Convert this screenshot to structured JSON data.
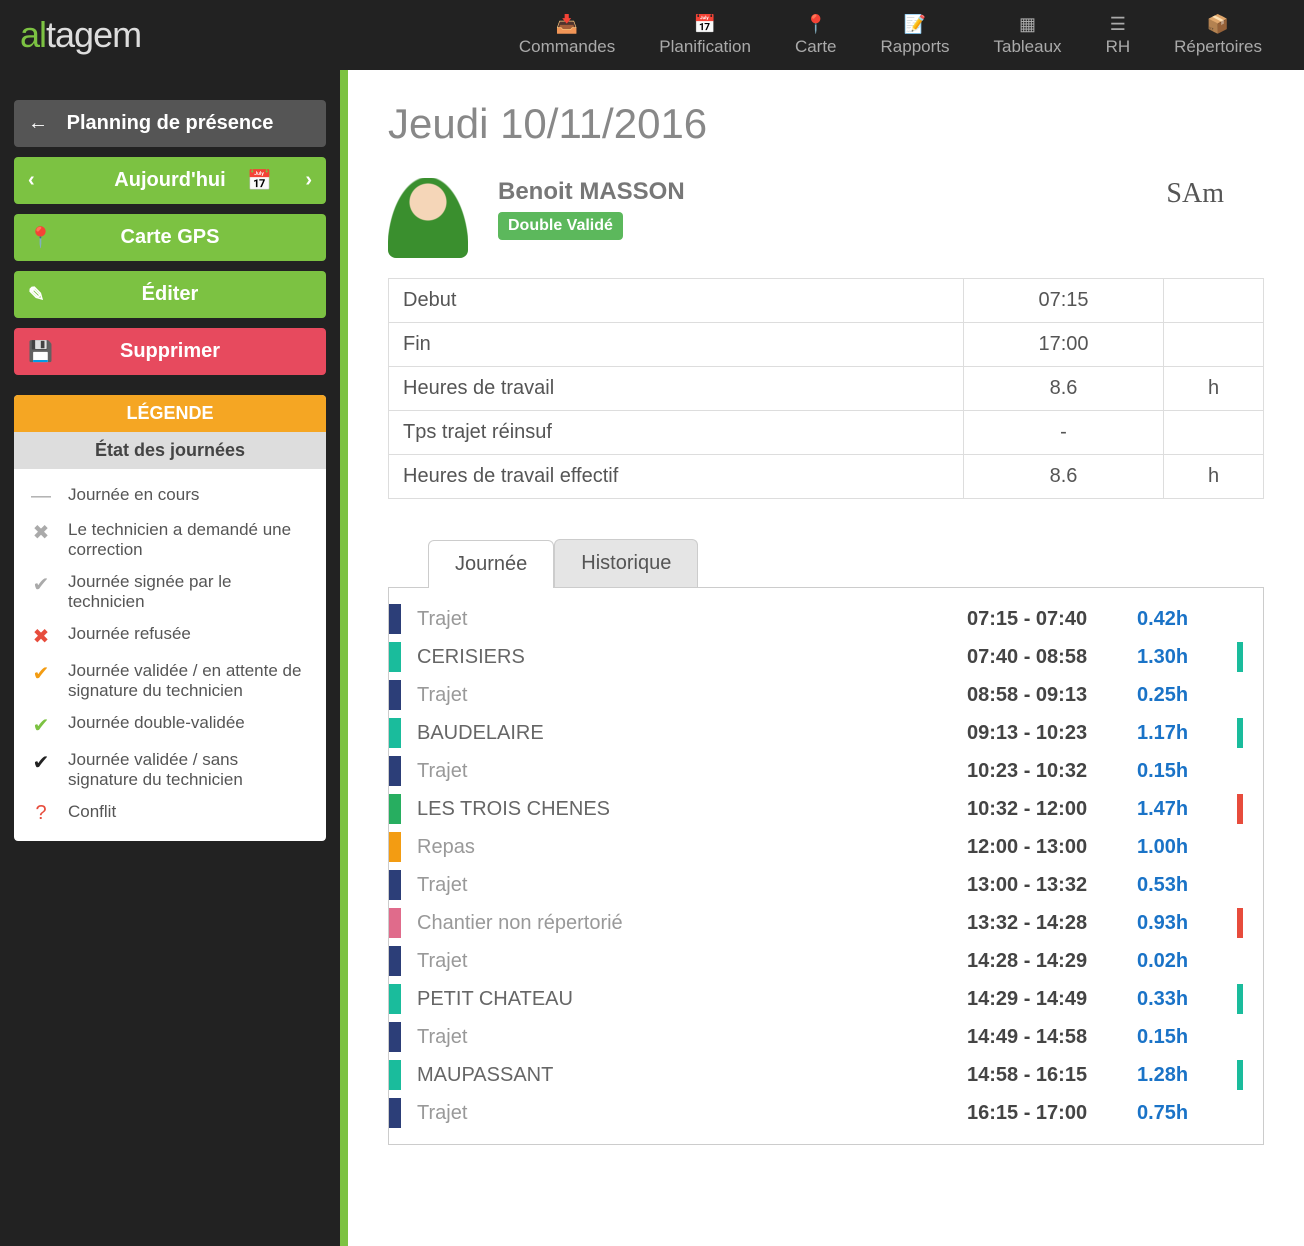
{
  "topnav": [
    {
      "icon": "📥",
      "label": "Commandes"
    },
    {
      "icon": "📅",
      "label": "Planification"
    },
    {
      "icon": "📍",
      "label": "Carte"
    },
    {
      "icon": "📝",
      "label": "Rapports"
    },
    {
      "icon": "▦",
      "label": "Tableaux"
    },
    {
      "icon": "☰",
      "label": "RH"
    },
    {
      "icon": "📦",
      "label": "Répertoires"
    }
  ],
  "sidebar": {
    "back": "Planning de présence",
    "today": "Aujourd'hui",
    "gps": "Carte GPS",
    "edit": "Éditer",
    "delete": "Supprimer"
  },
  "legend": {
    "title": "LÉGENDE",
    "subtitle": "État des journées",
    "items": [
      {
        "icon": "—",
        "cls": "c-grey",
        "text": "Journée en cours"
      },
      {
        "icon": "✖",
        "cls": "c-grey",
        "text": "Le technicien a demandé une correction"
      },
      {
        "icon": "✔",
        "cls": "c-grey",
        "text": "Journée signée par le technicien"
      },
      {
        "icon": "✖",
        "cls": "c-red",
        "text": "Journée refusée"
      },
      {
        "icon": "✔",
        "cls": "c-orange",
        "text": "Journée validée / en attente de signature du technicien"
      },
      {
        "icon": "✔",
        "cls": "c-green",
        "text": "Journée double-validée"
      },
      {
        "icon": "✔",
        "cls": "c-black",
        "text": "Journée validée / sans signature du technicien"
      },
      {
        "icon": "?",
        "cls": "c-red",
        "text": "Conflit"
      }
    ]
  },
  "page": {
    "title": "Jeudi 10/11/2016",
    "person": "Benoit MASSON",
    "badge": "Double Validé",
    "signature": "SAm"
  },
  "info": [
    {
      "label": "Debut",
      "val": "07:15",
      "unit": ""
    },
    {
      "label": "Fin",
      "val": "17:00",
      "unit": ""
    },
    {
      "label": "Heures de travail",
      "val": "8.6",
      "unit": "h"
    },
    {
      "label": "Tps trajet réinsuf",
      "val": "-",
      "unit": ""
    },
    {
      "label": "Heures de travail effectif",
      "val": "8.6",
      "unit": "h"
    }
  ],
  "tabs": {
    "active": "Journée",
    "inactive": "Historique"
  },
  "rows": [
    {
      "bar": "blue",
      "label": "Trajet",
      "muted": true,
      "time": "07:15 - 07:40",
      "dur": "0.42h",
      "rbar": ""
    },
    {
      "bar": "teal",
      "label": "CERISIERS",
      "muted": false,
      "time": "07:40 - 08:58",
      "dur": "1.30h",
      "rbar": "teal"
    },
    {
      "bar": "blue",
      "label": "Trajet",
      "muted": true,
      "time": "08:58 - 09:13",
      "dur": "0.25h",
      "rbar": ""
    },
    {
      "bar": "teal",
      "label": "BAUDELAIRE",
      "muted": false,
      "time": "09:13 - 10:23",
      "dur": "1.17h",
      "rbar": "teal"
    },
    {
      "bar": "blue",
      "label": "Trajet",
      "muted": true,
      "time": "10:23 - 10:32",
      "dur": "0.15h",
      "rbar": ""
    },
    {
      "bar": "green",
      "label": "LES TROIS CHENES",
      "muted": false,
      "time": "10:32 - 12:00",
      "dur": "1.47h",
      "rbar": "red"
    },
    {
      "bar": "orange",
      "label": "Repas",
      "muted": true,
      "time": "12:00 - 13:00",
      "dur": "1.00h",
      "rbar": ""
    },
    {
      "bar": "blue",
      "label": "Trajet",
      "muted": true,
      "time": "13:00 - 13:32",
      "dur": "0.53h",
      "rbar": ""
    },
    {
      "bar": "pink",
      "label": "Chantier non répertorié",
      "muted": true,
      "time": "13:32 - 14:28",
      "dur": "0.93h",
      "rbar": "red"
    },
    {
      "bar": "blue",
      "label": "Trajet",
      "muted": true,
      "time": "14:28 - 14:29",
      "dur": "0.02h",
      "rbar": ""
    },
    {
      "bar": "teal",
      "label": "PETIT CHATEAU",
      "muted": false,
      "time": "14:29 - 14:49",
      "dur": "0.33h",
      "rbar": "teal"
    },
    {
      "bar": "blue",
      "label": "Trajet",
      "muted": true,
      "time": "14:49 - 14:58",
      "dur": "0.15h",
      "rbar": ""
    },
    {
      "bar": "teal",
      "label": "MAUPASSANT",
      "muted": false,
      "time": "14:58 - 16:15",
      "dur": "1.28h",
      "rbar": "teal"
    },
    {
      "bar": "blue",
      "label": "Trajet",
      "muted": true,
      "time": "16:15 - 17:00",
      "dur": "0.75h",
      "rbar": ""
    }
  ]
}
